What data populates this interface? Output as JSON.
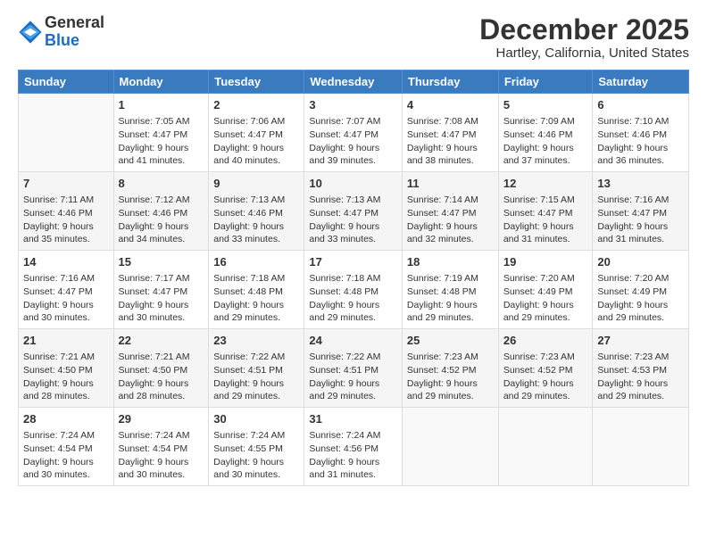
{
  "logo": {
    "general": "General",
    "blue": "Blue"
  },
  "header": {
    "title": "December 2025",
    "subtitle": "Hartley, California, United States"
  },
  "weekdays": [
    "Sunday",
    "Monday",
    "Tuesday",
    "Wednesday",
    "Thursday",
    "Friday",
    "Saturday"
  ],
  "weeks": [
    [
      {
        "day": "",
        "sunrise": "",
        "sunset": "",
        "daylight": ""
      },
      {
        "day": "1",
        "sunrise": "Sunrise: 7:05 AM",
        "sunset": "Sunset: 4:47 PM",
        "daylight": "Daylight: 9 hours and 41 minutes."
      },
      {
        "day": "2",
        "sunrise": "Sunrise: 7:06 AM",
        "sunset": "Sunset: 4:47 PM",
        "daylight": "Daylight: 9 hours and 40 minutes."
      },
      {
        "day": "3",
        "sunrise": "Sunrise: 7:07 AM",
        "sunset": "Sunset: 4:47 PM",
        "daylight": "Daylight: 9 hours and 39 minutes."
      },
      {
        "day": "4",
        "sunrise": "Sunrise: 7:08 AM",
        "sunset": "Sunset: 4:47 PM",
        "daylight": "Daylight: 9 hours and 38 minutes."
      },
      {
        "day": "5",
        "sunrise": "Sunrise: 7:09 AM",
        "sunset": "Sunset: 4:46 PM",
        "daylight": "Daylight: 9 hours and 37 minutes."
      },
      {
        "day": "6",
        "sunrise": "Sunrise: 7:10 AM",
        "sunset": "Sunset: 4:46 PM",
        "daylight": "Daylight: 9 hours and 36 minutes."
      }
    ],
    [
      {
        "day": "7",
        "sunrise": "Sunrise: 7:11 AM",
        "sunset": "Sunset: 4:46 PM",
        "daylight": "Daylight: 9 hours and 35 minutes."
      },
      {
        "day": "8",
        "sunrise": "Sunrise: 7:12 AM",
        "sunset": "Sunset: 4:46 PM",
        "daylight": "Daylight: 9 hours and 34 minutes."
      },
      {
        "day": "9",
        "sunrise": "Sunrise: 7:13 AM",
        "sunset": "Sunset: 4:46 PM",
        "daylight": "Daylight: 9 hours and 33 minutes."
      },
      {
        "day": "10",
        "sunrise": "Sunrise: 7:13 AM",
        "sunset": "Sunset: 4:47 PM",
        "daylight": "Daylight: 9 hours and 33 minutes."
      },
      {
        "day": "11",
        "sunrise": "Sunrise: 7:14 AM",
        "sunset": "Sunset: 4:47 PM",
        "daylight": "Daylight: 9 hours and 32 minutes."
      },
      {
        "day": "12",
        "sunrise": "Sunrise: 7:15 AM",
        "sunset": "Sunset: 4:47 PM",
        "daylight": "Daylight: 9 hours and 31 minutes."
      },
      {
        "day": "13",
        "sunrise": "Sunrise: 7:16 AM",
        "sunset": "Sunset: 4:47 PM",
        "daylight": "Daylight: 9 hours and 31 minutes."
      }
    ],
    [
      {
        "day": "14",
        "sunrise": "Sunrise: 7:16 AM",
        "sunset": "Sunset: 4:47 PM",
        "daylight": "Daylight: 9 hours and 30 minutes."
      },
      {
        "day": "15",
        "sunrise": "Sunrise: 7:17 AM",
        "sunset": "Sunset: 4:47 PM",
        "daylight": "Daylight: 9 hours and 30 minutes."
      },
      {
        "day": "16",
        "sunrise": "Sunrise: 7:18 AM",
        "sunset": "Sunset: 4:48 PM",
        "daylight": "Daylight: 9 hours and 29 minutes."
      },
      {
        "day": "17",
        "sunrise": "Sunrise: 7:18 AM",
        "sunset": "Sunset: 4:48 PM",
        "daylight": "Daylight: 9 hours and 29 minutes."
      },
      {
        "day": "18",
        "sunrise": "Sunrise: 7:19 AM",
        "sunset": "Sunset: 4:48 PM",
        "daylight": "Daylight: 9 hours and 29 minutes."
      },
      {
        "day": "19",
        "sunrise": "Sunrise: 7:20 AM",
        "sunset": "Sunset: 4:49 PM",
        "daylight": "Daylight: 9 hours and 29 minutes."
      },
      {
        "day": "20",
        "sunrise": "Sunrise: 7:20 AM",
        "sunset": "Sunset: 4:49 PM",
        "daylight": "Daylight: 9 hours and 29 minutes."
      }
    ],
    [
      {
        "day": "21",
        "sunrise": "Sunrise: 7:21 AM",
        "sunset": "Sunset: 4:50 PM",
        "daylight": "Daylight: 9 hours and 28 minutes."
      },
      {
        "day": "22",
        "sunrise": "Sunrise: 7:21 AM",
        "sunset": "Sunset: 4:50 PM",
        "daylight": "Daylight: 9 hours and 28 minutes."
      },
      {
        "day": "23",
        "sunrise": "Sunrise: 7:22 AM",
        "sunset": "Sunset: 4:51 PM",
        "daylight": "Daylight: 9 hours and 29 minutes."
      },
      {
        "day": "24",
        "sunrise": "Sunrise: 7:22 AM",
        "sunset": "Sunset: 4:51 PM",
        "daylight": "Daylight: 9 hours and 29 minutes."
      },
      {
        "day": "25",
        "sunrise": "Sunrise: 7:23 AM",
        "sunset": "Sunset: 4:52 PM",
        "daylight": "Daylight: 9 hours and 29 minutes."
      },
      {
        "day": "26",
        "sunrise": "Sunrise: 7:23 AM",
        "sunset": "Sunset: 4:52 PM",
        "daylight": "Daylight: 9 hours and 29 minutes."
      },
      {
        "day": "27",
        "sunrise": "Sunrise: 7:23 AM",
        "sunset": "Sunset: 4:53 PM",
        "daylight": "Daylight: 9 hours and 29 minutes."
      }
    ],
    [
      {
        "day": "28",
        "sunrise": "Sunrise: 7:24 AM",
        "sunset": "Sunset: 4:54 PM",
        "daylight": "Daylight: 9 hours and 30 minutes."
      },
      {
        "day": "29",
        "sunrise": "Sunrise: 7:24 AM",
        "sunset": "Sunset: 4:54 PM",
        "daylight": "Daylight: 9 hours and 30 minutes."
      },
      {
        "day": "30",
        "sunrise": "Sunrise: 7:24 AM",
        "sunset": "Sunset: 4:55 PM",
        "daylight": "Daylight: 9 hours and 30 minutes."
      },
      {
        "day": "31",
        "sunrise": "Sunrise: 7:24 AM",
        "sunset": "Sunset: 4:56 PM",
        "daylight": "Daylight: 9 hours and 31 minutes."
      },
      {
        "day": "",
        "sunrise": "",
        "sunset": "",
        "daylight": ""
      },
      {
        "day": "",
        "sunrise": "",
        "sunset": "",
        "daylight": ""
      },
      {
        "day": "",
        "sunrise": "",
        "sunset": "",
        "daylight": ""
      }
    ]
  ]
}
